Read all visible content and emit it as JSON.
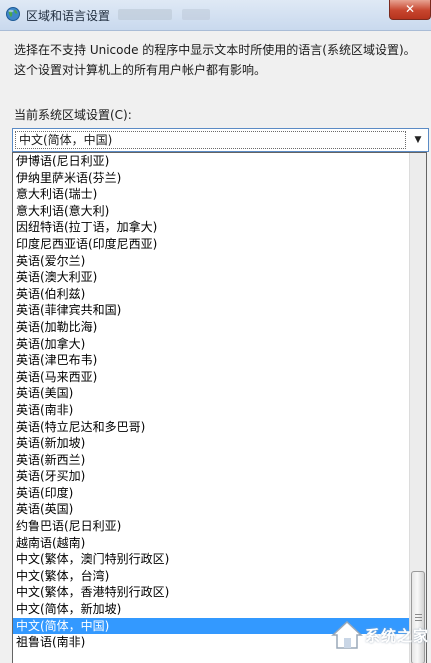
{
  "window": {
    "title": "区域和语言设置",
    "close_label": "✕"
  },
  "description": "选择在不支持 Unicode 的程序中显示文本时所使用的语言(系统区域设置)。这个设置对计算机上的所有用户帐户都有影响。",
  "locale": {
    "label": "当前系统区域设置(C):",
    "selected": "中文(简体，中国)",
    "options": [
      "伊博语(尼日利亚)",
      "伊纳里萨米语(芬兰)",
      "意大利语(瑞士)",
      "意大利语(意大利)",
      "因纽特语(拉丁语，加拿大)",
      "印度尼西亚语(印度尼西亚)",
      "英语(爱尔兰)",
      "英语(澳大利亚)",
      "英语(伯利兹)",
      "英语(菲律宾共和国)",
      "英语(加勒比海)",
      "英语(加拿大)",
      "英语(津巴布韦)",
      "英语(马来西亚)",
      "英语(美国)",
      "英语(南非)",
      "英语(特立尼达和多巴哥)",
      "英语(新加坡)",
      "英语(新西兰)",
      "英语(牙买加)",
      "英语(印度)",
      "英语(英国)",
      "约鲁巴语(尼日利亚)",
      "越南语(越南)",
      "中文(繁体，澳门特别行政区)",
      "中文(繁体，台湾)",
      "中文(繁体，香港特别行政区)",
      "中文(简体，新加坡)",
      "中文(简体，中国)",
      "祖鲁语(南非)"
    ],
    "selected_index": 28
  },
  "watermark": {
    "text": "系统之家"
  },
  "colors": {
    "selection": "#3399ff",
    "titlebar": "#c9d9ee",
    "close": "#c7452e"
  },
  "icons": {
    "app": "globe-icon",
    "dropdown": "chevron-down-icon"
  }
}
